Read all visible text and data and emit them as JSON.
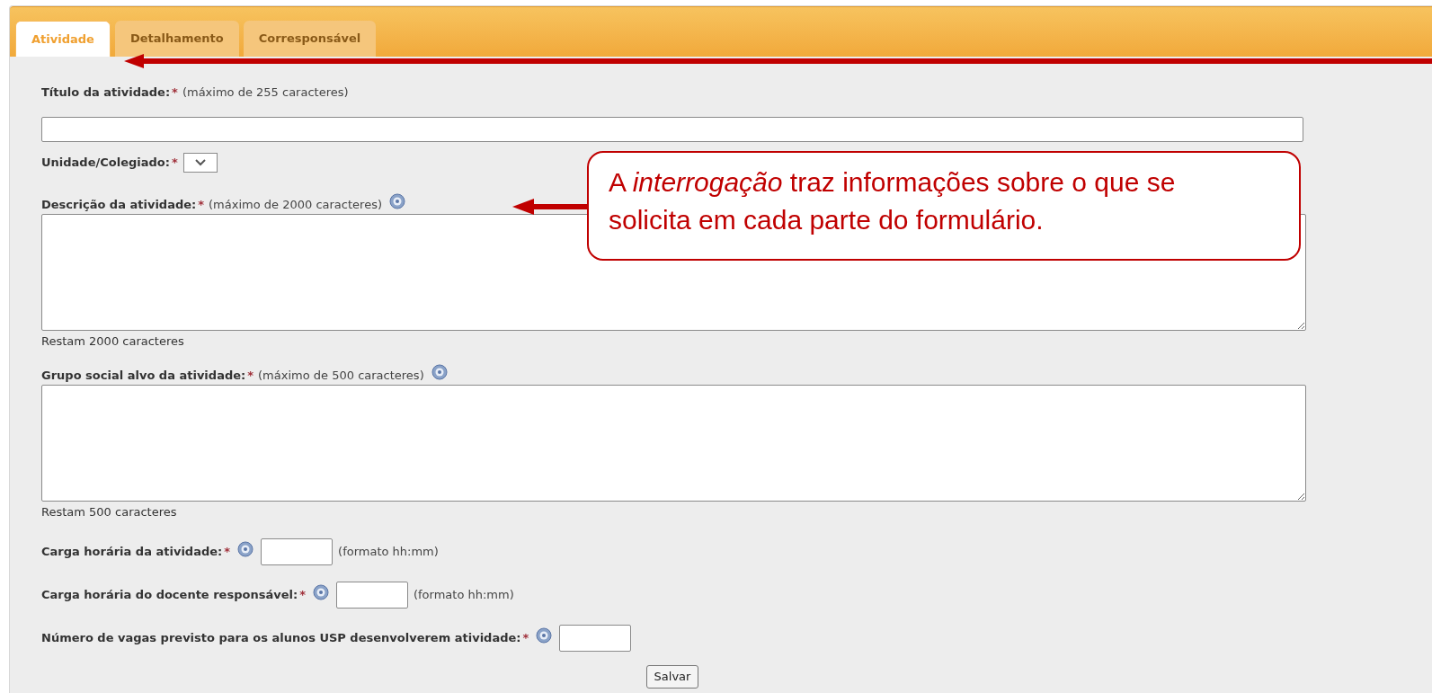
{
  "tabs": [
    {
      "label": "Atividade",
      "selected": true
    },
    {
      "label": "Detalhamento",
      "selected": false
    },
    {
      "label": "Corresponsável",
      "selected": false
    }
  ],
  "fields": [
    {
      "kind": "line",
      "label": "Título da atividade:",
      "required": "*",
      "hint": "(máximo de 255 caracteres)",
      "help": false
    },
    {
      "kind": "select",
      "label": "Unidade/Colegiado:",
      "required": "*",
      "help": false
    },
    {
      "kind": "textarea",
      "label": "Descrição da atividade:",
      "required": "*",
      "hint": "(máximo de 2000 caracteres)",
      "help": true,
      "counter": "Restam 2000 caracteres"
    },
    {
      "kind": "textarea",
      "label": "Grupo social alvo da atividade:",
      "required": "*",
      "hint": "(máximo de 500 caracteres)",
      "help": true,
      "counter": "Restam 500 caracteres"
    },
    {
      "kind": "short",
      "label": "Carga horária da atividade:",
      "required": "*",
      "help": true,
      "suffix": "(formato hh:mm)"
    },
    {
      "kind": "short",
      "label": "Carga horária do docente responsável:",
      "required": "*",
      "help": true,
      "suffix": "(formato hh:mm)"
    },
    {
      "kind": "short",
      "label": "Número de vagas previsto para os alunos USP desenvolverem atividade:",
      "required": "*",
      "help": true
    }
  ],
  "save_button": "Salvar",
  "callout": {
    "text": "A *interrogação* traz informações sobre o que se solicita em cada parte do formulário."
  }
}
